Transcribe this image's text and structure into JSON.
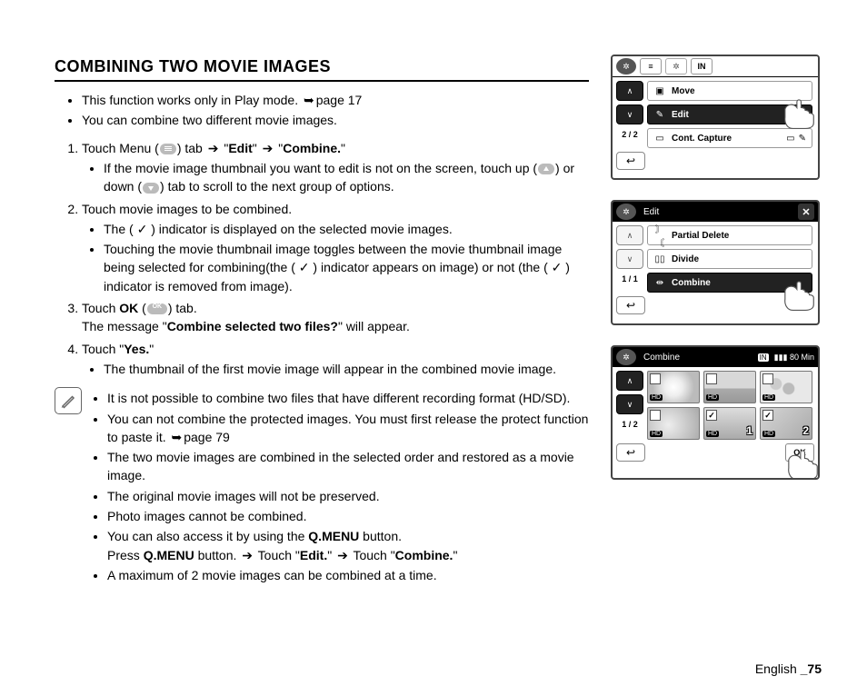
{
  "title": "COMBINING TWO MOVIE IMAGES",
  "intro": {
    "l1a": "This function works only in Play mode. ",
    "l1b": "page 17",
    "l2": "You can combine two different movie images."
  },
  "steps": {
    "s1": {
      "a": "Touch Menu (",
      "b": ") tab ",
      "c": " \"",
      "edit": "Edit",
      "d": "\" ",
      "e": " \"",
      "combine": "Combine.",
      "f": "\"",
      "sub1a": "If the movie image thumbnail you want to edit is not on the screen, touch up (",
      "sub1b": ") or down (",
      "sub1c": ") tab to scroll to the next group of options."
    },
    "s2": {
      "head": "Touch movie images to be combined.",
      "sub1a": "The ( ",
      "sub1b": " ) indicator is displayed on the selected movie images.",
      "sub2a": "Touching the movie thumbnail image toggles between the movie thumbnail image being selected for combining(the ( ",
      "sub2b": " ) indicator appears on image) or not (the ( ",
      "sub2c": " ) indicator is removed from image)."
    },
    "s3": {
      "a": "Touch ",
      "ok": "OK",
      "b": " (",
      "c": ") tab.",
      "msg_a": "The message \"",
      "msg_b": "Combine selected two files?",
      "msg_c": "\" will appear."
    },
    "s4": {
      "a": "Touch \"",
      "yes": "Yes.",
      "b": "\"",
      "sub": "The thumbnail of the first movie image will appear in the combined movie image."
    }
  },
  "notes": {
    "n1": "It is not possible to combine two files that have different recording format (HD/SD).",
    "n2a": "You can not combine the protected images. You must first release the protect function to paste it. ",
    "n2b": "page 79",
    "n3": "The two movie images are combined in the selected order and restored as a movie image.",
    "n4": "The original movie images will not be preserved.",
    "n5": "Photo images cannot be combined.",
    "n6a": "You can also access it by using the ",
    "n6b": "Q.MENU",
    "n6c": " button.",
    "n6d": "Press ",
    "n6e": "Q.MENU",
    "n6f": " button. ",
    "n6g": " Touch \"",
    "n6h": "Edit.",
    "n6i": "\" ",
    "n6j": " Touch \"",
    "n6k": "Combine.",
    "n6l": "\"",
    "n7": "A maximum of 2 movie images can be combined at a time."
  },
  "footer": {
    "lang": "English ",
    "page": "_75"
  },
  "shot1": {
    "storage": "IN",
    "items": {
      "move": "Move",
      "edit": "Edit",
      "cont": "Cont. Capture"
    },
    "counter": "2 / 2"
  },
  "shot2": {
    "title": "Edit",
    "items": {
      "pd": "Partial Delete",
      "div": "Divide",
      "comb": "Combine"
    },
    "counter": "1 / 1"
  },
  "shot3": {
    "title": "Combine",
    "battery": "80 Min",
    "storage": "IN",
    "counter": "1 / 2",
    "hd": "HD",
    "ok": "OK",
    "n1": "1",
    "n2": "2"
  }
}
